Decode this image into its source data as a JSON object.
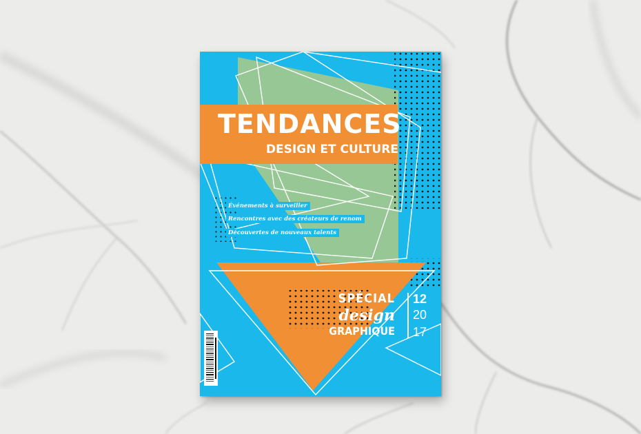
{
  "magazine": {
    "title": "TENDANCES",
    "subtitle": "DESIGN ET CULTURE",
    "features": [
      "Événements à surveiller",
      "Rencontres avec des créateurs de renom",
      "Découvertes de nouveaux talents"
    ],
    "special": {
      "line1": "SPÉCIAL",
      "line2": "design",
      "line3": "GRAPHIQUE"
    },
    "issue": {
      "number": "12",
      "year_top": "20",
      "year_bottom": "17"
    }
  },
  "colors": {
    "cover_blue": "#1bb8ec",
    "cover_orange": "#f08f33",
    "cover_green": "#96c795",
    "text_white": "#ffffff",
    "dots_black": "#1a1a1a",
    "marble": "#ececeb"
  }
}
